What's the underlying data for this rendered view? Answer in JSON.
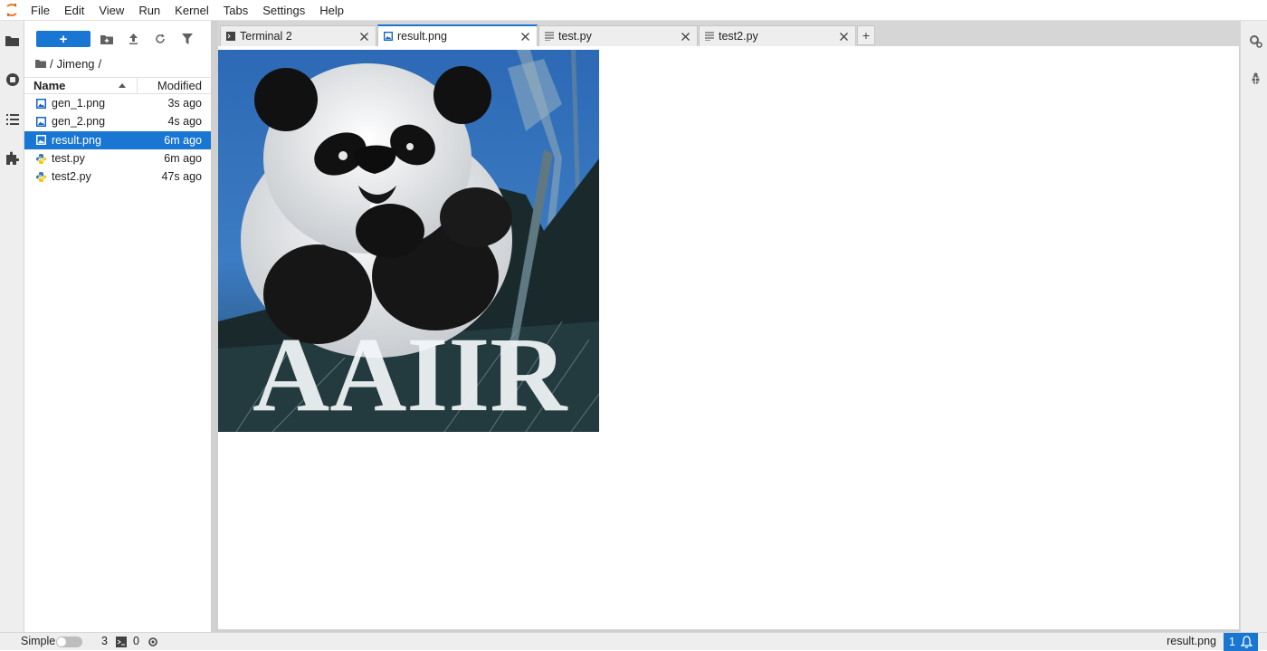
{
  "menubar": {
    "logo": "jupyter-logo-icon",
    "items": [
      "File",
      "Edit",
      "View",
      "Run",
      "Kernel",
      "Tabs",
      "Settings",
      "Help"
    ]
  },
  "activitybar": {
    "icons": [
      "folder-icon",
      "running-icon",
      "toc-icon",
      "extension-icon"
    ]
  },
  "filebrowser": {
    "new_button_label": "+",
    "toolbar_icons": [
      "new-folder-icon",
      "upload-icon",
      "refresh-icon",
      "filter-icon"
    ],
    "breadcrumb": {
      "icon": "folder-icon",
      "root": "/",
      "folder": "Jimeng",
      "trail": "/"
    },
    "header": {
      "name": "Name",
      "modified": "Modified"
    },
    "files": [
      {
        "name": "gen_1.png",
        "modified": "3s ago",
        "icon": "image-file-icon"
      },
      {
        "name": "gen_2.png",
        "modified": "4s ago",
        "icon": "image-file-icon"
      },
      {
        "name": "result.png",
        "modified": "6m ago",
        "icon": "image-file-icon",
        "selected": true
      },
      {
        "name": "test.py",
        "modified": "6m ago",
        "icon": "python-file-icon"
      },
      {
        "name": "test2.py",
        "modified": "47s ago",
        "icon": "python-file-icon"
      }
    ]
  },
  "tabs": [
    {
      "label": "Terminal 2",
      "icon": "terminal-icon",
      "active": false
    },
    {
      "label": "result.png",
      "icon": "image-file-icon",
      "active": true
    },
    {
      "label": "test.py",
      "icon": "text-file-icon",
      "active": false
    },
    {
      "label": "test2.py",
      "icon": "text-file-icon",
      "active": false
    }
  ],
  "add_tab_label": "+",
  "viewer": {
    "image_text": "AAIIR"
  },
  "rightbar": {
    "icons": [
      "property-inspector-icon",
      "debugger-icon"
    ]
  },
  "statusbar": {
    "mode_label": "Simple",
    "terminals_count": "3",
    "kernels_count": "0",
    "current_file": "result.png",
    "notifications_count": "1"
  },
  "colors": {
    "accent": "#1976d2",
    "selected_row": "#1976d2"
  }
}
